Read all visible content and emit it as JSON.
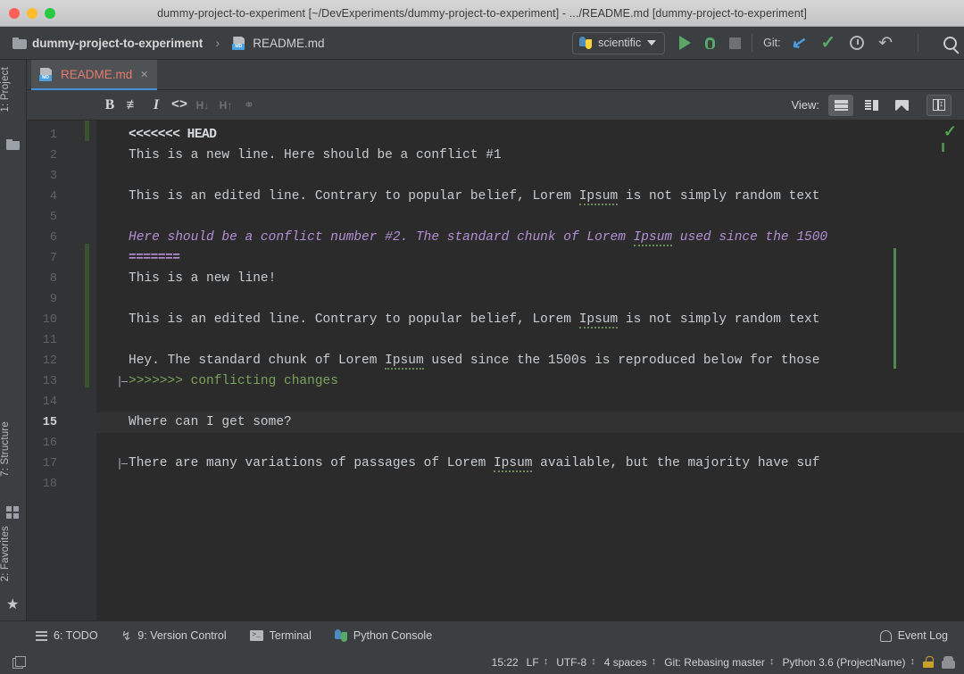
{
  "window": {
    "title": "dummy-project-to-experiment [~/DevExperiments/dummy-project-to-experiment] - .../README.md [dummy-project-to-experiment]",
    "traffic_lights": [
      "close-red",
      "minimize-yellow",
      "maximize-green"
    ]
  },
  "toolbar": {
    "breadcrumb_project": "dummy-project-to-experiment",
    "breadcrumb_sep": "›",
    "breadcrumb_file": "README.md",
    "md_badge": "MD",
    "run_config": "scientific",
    "git_label": "Git:",
    "icons": {
      "run": "run-triangle-icon",
      "debug": "debug-bug-icon",
      "stop": "stop-square-icon",
      "update_project": "vcs-update-arrow-icon",
      "commit": "vcs-commit-check-icon",
      "history": "vcs-history-clock-icon",
      "rollback": "vcs-rollback-undo-icon",
      "search": "search-everywhere-icon"
    }
  },
  "left_tool_stripe": {
    "items": [
      {
        "label": "1: Project",
        "icon": "project-folder-icon"
      },
      {
        "label": "7: Structure",
        "icon": "structure-grid-icon"
      },
      {
        "label": "2: Favorites",
        "icon": "favorites-star-icon"
      }
    ]
  },
  "editor_tabs": [
    {
      "label": "README.md",
      "badge": "MD",
      "close": "×",
      "active": true,
      "modified": true
    }
  ],
  "markdown_toolbar": {
    "buttons": [
      {
        "name": "bold",
        "glyph": "B",
        "enabled": true
      },
      {
        "name": "strikethrough",
        "glyph": "S",
        "enabled": true
      },
      {
        "name": "italic",
        "glyph": "I",
        "enabled": true
      },
      {
        "name": "code",
        "glyph": "<>",
        "enabled": true
      },
      {
        "name": "heading-down",
        "glyph": "H↓",
        "enabled": false
      },
      {
        "name": "heading-up",
        "glyph": "H↑",
        "enabled": false
      },
      {
        "name": "link",
        "glyph": "⚭",
        "enabled": false
      }
    ],
    "view_label": "View:",
    "view_buttons": [
      {
        "name": "editor-only",
        "icon": "lines-icon",
        "selected": true
      },
      {
        "name": "editor-preview",
        "icon": "split-icon",
        "selected": false
      },
      {
        "name": "preview-only",
        "icon": "image-icon",
        "selected": false
      },
      {
        "name": "split-vertical",
        "icon": "columns-icon",
        "selected": true
      }
    ]
  },
  "editor": {
    "current_line": 15,
    "total_lines": 18,
    "inspection_status": "✓",
    "lines": [
      {
        "n": 1,
        "text": "<<<<<<< HEAD",
        "style": "conflict-top",
        "stripe": true,
        "fold": false
      },
      {
        "n": 2,
        "text": "This is a new line. Here should be a conflict #1",
        "style": "plain",
        "stripe": false,
        "fold": false
      },
      {
        "n": 3,
        "text": "",
        "style": "plain",
        "stripe": false,
        "fold": false
      },
      {
        "n": 4,
        "text": "This is an edited line. Contrary to popular belief, Lorem Ipsum is not simply random text",
        "style": "plain",
        "stripe": false,
        "fold": false
      },
      {
        "n": 5,
        "text": "",
        "style": "plain",
        "stripe": false,
        "fold": false
      },
      {
        "n": 6,
        "text": "Here should be a conflict number #2. The standard chunk of Lorem Ipsum used since the 1500",
        "style": "italic",
        "stripe": false,
        "fold": false
      },
      {
        "n": 7,
        "text": "=======",
        "style": "separator",
        "stripe": true,
        "fold": false
      },
      {
        "n": 8,
        "text": "This is a new line!",
        "style": "plain",
        "stripe": true,
        "fold": false
      },
      {
        "n": 9,
        "text": "",
        "style": "plain",
        "stripe": true,
        "fold": false
      },
      {
        "n": 10,
        "text": "This is an edited line. Contrary to popular belief, Lorem Ipsum is not simply random text",
        "style": "plain",
        "stripe": true,
        "fold": false
      },
      {
        "n": 11,
        "text": "",
        "style": "plain",
        "stripe": true,
        "fold": false
      },
      {
        "n": 12,
        "text": "Hey. The standard chunk of Lorem Ipsum used since the 1500s is reproduced below for those",
        "style": "plain",
        "stripe": true,
        "fold": false
      },
      {
        "n": 13,
        "text": ">>>>>>> conflicting changes",
        "style": "conflict-bottom",
        "stripe": true,
        "fold": true
      },
      {
        "n": 14,
        "text": "",
        "style": "plain",
        "stripe": false,
        "fold": false
      },
      {
        "n": 15,
        "text": "Where can I get some?",
        "style": "plain",
        "stripe": false,
        "fold": false
      },
      {
        "n": 16,
        "text": "",
        "style": "plain",
        "stripe": false,
        "fold": false
      },
      {
        "n": 17,
        "text": "There are many variations of passages of Lorem Ipsum available, but the majority have suf",
        "style": "plain",
        "stripe": false,
        "fold": true
      },
      {
        "n": 18,
        "text": "",
        "style": "plain",
        "stripe": false,
        "fold": false
      }
    ],
    "colors": {
      "background": "#2b2b2b",
      "gutter": "#313335",
      "text": "#c7cdd1",
      "conflict_top": "#d8dde0",
      "separator": "#b58fd6",
      "conflict_bottom": "#7aa25c",
      "italic": "#b58fd6",
      "stripe": "#375330",
      "current_line": "#323232"
    }
  },
  "bottom_tool_bar": {
    "items": [
      {
        "label": "6: TODO",
        "icon": "todo-list-icon"
      },
      {
        "label": "9: Version Control",
        "icon": "vcs-branch-icon"
      },
      {
        "label": "Terminal",
        "icon": "terminal-icon"
      },
      {
        "label": "Python Console",
        "icon": "python-console-icon"
      }
    ],
    "event_log": "Event Log",
    "event_log_icon": "bell-icon"
  },
  "status_bar": {
    "window_icon": "detach-window-icon",
    "cursor_position": "15:22",
    "line_separator": "LF",
    "encoding": "UTF-8",
    "indent": "4 spaces",
    "vcs_branch": "Git: Rebasing master",
    "interpreter": "Python 3.6 (ProjectName)",
    "lock_icon": "readonly-lock-icon",
    "inspection_icon": "inspections-icon",
    "chevron": "↕"
  }
}
